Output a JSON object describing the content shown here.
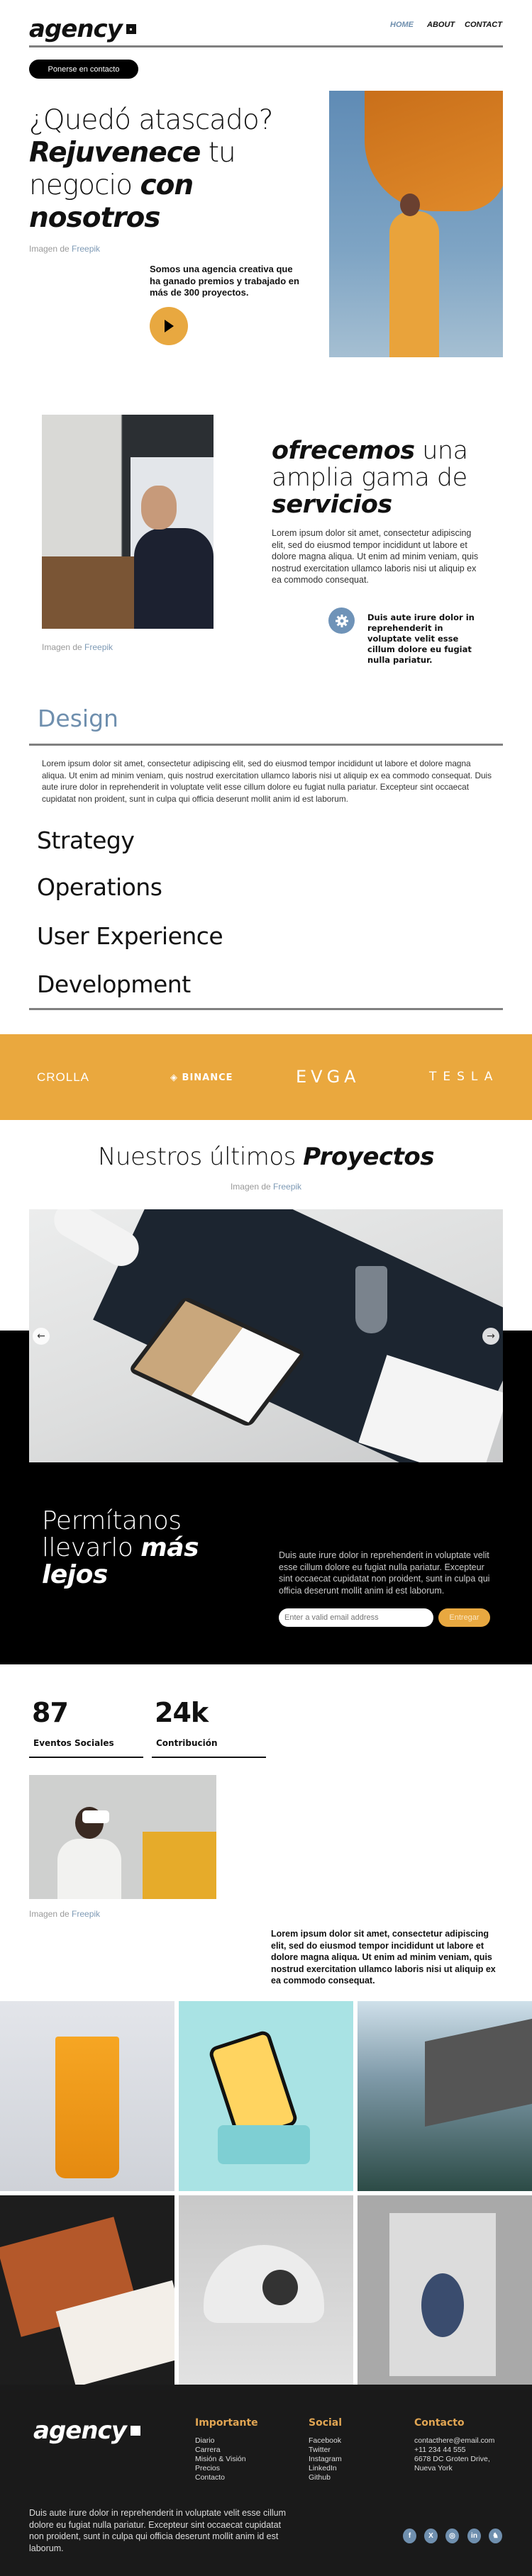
{
  "header": {
    "logo_text": "agency",
    "nav": [
      {
        "label": "HOME",
        "active": true
      },
      {
        "label": "ABOUT"
      },
      {
        "label": "CONTACT"
      }
    ],
    "cta_label": "Ponerse en contacto"
  },
  "hero": {
    "line1": "¿Quedó atascado?",
    "line2_bold": "Rejuvenece",
    "line2_rest": " tu",
    "line3_light": "negocio ",
    "line3_bold": "con",
    "line4_bold": "nosotros",
    "caption_prefix": "Imagen de ",
    "caption_link": "Freepik",
    "tagline": "Somos una agencia creativa que ha ganado premios y trabajado en más de 300 proyectos.",
    "play_icon": "play-icon"
  },
  "services_intro": {
    "caption_prefix": "Imagen de ",
    "caption_link": "Freepik",
    "title_bold": "ofrecemos",
    "title_light_1": " una",
    "title_light_2": "amplia gama de",
    "title_bold_2": "servicios",
    "body": "Lorem ipsum dolor sit amet, consectetur adipiscing elit, sed do eiusmod tempor incididunt ut labore et dolore magna aliqua. Ut enim ad minim veniam, quis nostrud exercitation ullamco laboris nisi ut aliquip ex ea commodo consequat.",
    "feature_icon": "gear-icon",
    "feature_text": "Duis aute irure dolor in reprehenderit in voluptate velit esse cillum dolore eu fugiat nulla pariatur."
  },
  "accordion": {
    "open_title": "Design",
    "open_body": "Lorem ipsum dolor sit amet, consectetur adipiscing elit, sed do eiusmod tempor incididunt ut labore et dolore magna aliqua. Ut enim ad minim veniam, quis nostrud exercitation ullamco laboris nisi ut aliquip ex ea commodo consequat. Duis aute irure dolor in reprehenderit in voluptate velit esse cillum dolore eu fugiat nulla pariatur. Excepteur sint occaecat cupidatat non proident, sunt in culpa qui officia deserunt mollit anim id est laborum.",
    "items": [
      "Strategy",
      "Operations",
      "User Experience",
      "Development"
    ]
  },
  "brands": {
    "items": [
      "CROLLA",
      "BINANCE",
      "EVGA",
      "TESLA"
    ],
    "color": "#eaa83e"
  },
  "projects": {
    "title_light": "Nuestros últimos ",
    "title_bold": "Proyectos",
    "caption_prefix": "Imagen de ",
    "caption_link": "Freepik",
    "prev_icon": "arrow-left-icon",
    "next_icon": "arrow-right-icon"
  },
  "newsletter": {
    "line1": "Permítanos",
    "line2_light": "llevarlo ",
    "line2_bold": "más",
    "line3_bold": "lejos",
    "body": "Duis aute irure dolor in reprehenderit in voluptate velit esse cillum dolore eu fugiat nulla pariatur. Excepteur sint occaecat cupidatat non proident, sunt in culpa qui officia deserunt mollit anim id est laborum.",
    "email_placeholder": "Enter a valid email address",
    "submit_label": "Entregar"
  },
  "stats": [
    {
      "value": "87",
      "label": "Eventos Sociales"
    },
    {
      "value": "24k",
      "label": "Contribución"
    }
  ],
  "about": {
    "caption_prefix": "Imagen de ",
    "caption_link": "Freepik",
    "body": "Lorem ipsum dolor sit amet, consectetur adipiscing elit, sed do eiusmod tempor incididunt ut labore et dolore magna aliqua. Ut enim ad minim veniam, quis nostrud exercitation ullamco laboris nisi ut aliquip ex ea commodo consequat."
  },
  "footer": {
    "logo_text": "agency",
    "col1": {
      "title": "Importante",
      "links": [
        "Diario",
        "Carrera",
        "Misión & Visión",
        "Precios",
        "Contacto"
      ]
    },
    "col2": {
      "title": "Social",
      "links": [
        "Facebook",
        "Twitter",
        "Instagram",
        "LinkedIn",
        "Github"
      ]
    },
    "col3": {
      "title": "Contacto",
      "lines": [
        "contacthere@email.com",
        "+11 234 44 555",
        "6678 DC Groten Drive,",
        "Nueva York"
      ]
    },
    "body": "Duis aute irure dolor in reprehenderit in voluptate velit esse cillum dolore eu fugiat nulla pariatur. Excepteur sint occaecat cupidatat non proident, sunt in culpa qui officia deserunt mollit anim id est laborum.",
    "social_icons": [
      {
        "name": "facebook-icon",
        "glyph": "f"
      },
      {
        "name": "x-icon",
        "glyph": "X"
      },
      {
        "name": "instagram-icon",
        "glyph": "◎"
      },
      {
        "name": "linkedin-icon",
        "glyph": "in"
      },
      {
        "name": "github-icon",
        "glyph": "♞"
      }
    ],
    "accent": "#e0a553"
  }
}
